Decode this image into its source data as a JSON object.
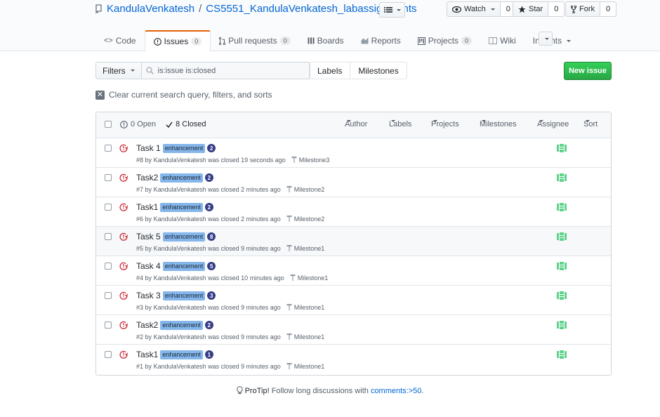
{
  "repo": {
    "owner": "KandulaVenkatesh",
    "separator": "/",
    "name": "CS5551_KandulaVenkatesh_labassignments"
  },
  "social": {
    "watch_label": "Watch",
    "watch_count": "0",
    "star_label": "Star",
    "star_count": "0",
    "fork_label": "Fork",
    "fork_count": "0"
  },
  "nav": {
    "code": "Code",
    "issues": "Issues",
    "issues_count": "0",
    "pulls": "Pull requests",
    "pulls_count": "0",
    "boards": "Boards",
    "reports": "Reports",
    "projects": "Projects",
    "projects_count": "0",
    "wiki": "Wiki",
    "insights": "Insights"
  },
  "subnav": {
    "filters_label": "Filters",
    "search_value": "is:issue is:closed",
    "labels_link": "Labels",
    "milestones_link": "Milestones",
    "new_issue": "New issue"
  },
  "clear_query": "Clear current search query, filters, and sorts",
  "states": {
    "open": "0 Open",
    "closed": "8 Closed"
  },
  "filter_menus": {
    "author": "Author",
    "labels": "Labels",
    "projects": "Projects",
    "milestones": "Milestones",
    "assignee": "Assignee",
    "sort": "Sort"
  },
  "issues": [
    {
      "title": "Task 1",
      "label": "enhancement",
      "badge": "2",
      "number": "#8",
      "by": "by",
      "author": "KandulaVenkatesh",
      "closed_text": "was closed 19 seconds ago",
      "milestone": "Milestone3"
    },
    {
      "title": "Task2",
      "label": "enhancement",
      "badge": "2",
      "number": "#7",
      "by": "by",
      "author": "KandulaVenkatesh",
      "closed_text": "was closed 2 minutes ago",
      "milestone": "Milestone2"
    },
    {
      "title": "Task1",
      "label": "enhancement",
      "badge": "2",
      "number": "#6",
      "by": "by",
      "author": "KandulaVenkatesh",
      "closed_text": "was closed 2 minutes ago",
      "milestone": "Milestone2"
    },
    {
      "title": "Task 5",
      "label": "enhancement",
      "badge": "8",
      "number": "#5",
      "by": "by",
      "author": "KandulaVenkatesh",
      "closed_text": "was closed 9 minutes ago",
      "milestone": "Milestone1"
    },
    {
      "title": "Task 4",
      "label": "enhancement",
      "badge": "5",
      "number": "#4",
      "by": "by",
      "author": "KandulaVenkatesh",
      "closed_text": "was closed 10 minutes ago",
      "milestone": "Milestone1"
    },
    {
      "title": "Task 3",
      "label": "enhancement",
      "badge": "3",
      "number": "#3",
      "by": "by",
      "author": "KandulaVenkatesh",
      "closed_text": "was closed 9 minutes ago",
      "milestone": "Milestone1"
    },
    {
      "title": "Task2",
      "label": "enhancement",
      "badge": "2",
      "number": "#2",
      "by": "by",
      "author": "KandulaVenkatesh",
      "closed_text": "was closed 9 minutes ago",
      "milestone": "Milestone1"
    },
    {
      "title": "Task1",
      "label": "enhancement",
      "badge": "1",
      "number": "#1",
      "by": "by",
      "author": "KandulaVenkatesh",
      "closed_text": "was closed 9 minutes ago",
      "milestone": "Milestone1"
    }
  ],
  "protip": {
    "strong": "ProTip!",
    "text": " Follow long discussions with ",
    "link": "comments:>50",
    "end": "."
  },
  "colors": {
    "accent_link": "#0366d6",
    "closed_red": "#cb2431",
    "label_blue": "#84b6eb",
    "badge_navy": "#353d87",
    "new_issue_green": "#28a745",
    "tab_orange": "#e36209"
  },
  "icons": {
    "repo": "repo-icon",
    "closed": "issue-closed-icon",
    "milestone": "milestone-icon",
    "avatar": "identicon-avatar"
  }
}
